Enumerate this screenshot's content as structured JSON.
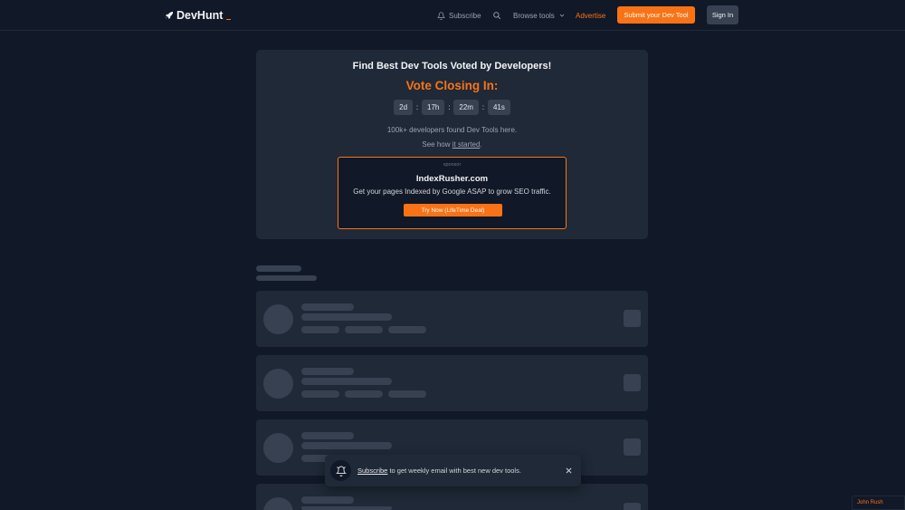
{
  "header": {
    "logo_text": "DevHunt",
    "nav": {
      "subscribe": "Subscribe",
      "browse_tools": "Browse tools",
      "advertise": "Advertise"
    },
    "submit_button": "Submit your Dev Tool",
    "signin_button": "Sign In"
  },
  "hero": {
    "title": "Find Best Dev Tools Voted by Developers!",
    "vote_title": "Vote Closing In:",
    "countdown": {
      "days": "2d",
      "hours": "17h",
      "minutes": "22m",
      "seconds": "41s",
      "separator": ":"
    },
    "subtitle": "100k+ developers found Dev Tools here.",
    "see_how_prefix": "See how ",
    "see_how_link": "it started",
    "see_how_suffix": "."
  },
  "sponsor": {
    "tag": "sponsor",
    "name": "IndexRusher.com",
    "description": "Get your pages Indexed by Google ASAP to grow SEO traffic.",
    "cta": "Try Now (LifeTime Deal)"
  },
  "toast": {
    "link": "Subscribe",
    "text": " to get weekly email with best new dev tools."
  },
  "badge": "John Rush",
  "colors": {
    "accent": "#f97316",
    "background": "#111827",
    "card": "#1f2937",
    "skeleton": "#374151"
  }
}
